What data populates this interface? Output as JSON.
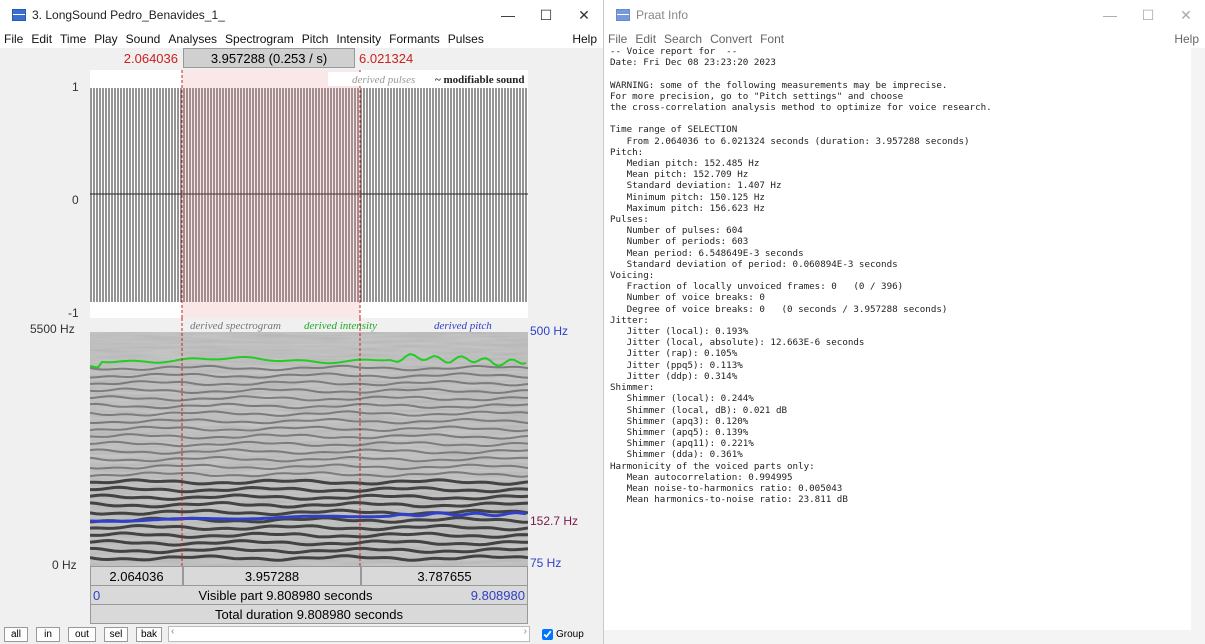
{
  "left": {
    "title": "3. LongSound Pedro_Benavides_1_",
    "menu": [
      "File",
      "Edit",
      "Time",
      "Play",
      "Sound",
      "Analyses",
      "Spectrogram",
      "Pitch",
      "Intensity",
      "Formants",
      "Pulses"
    ],
    "help": "Help",
    "sel_start": "2.064036",
    "sel_duration": "3.957288 (0.253 / s)",
    "sel_end": "6.021324",
    "wave": {
      "y_top": "1",
      "y_mid": "0",
      "y_bottom": "-1",
      "legend_pulses": "derived pulses",
      "legend_sound": "~ modifiable sound"
    },
    "spectro": {
      "freq_top": "5500 Hz",
      "freq_bottom": "0 Hz",
      "pitch_top": "500 Hz",
      "pitch_value": "152.7 Hz",
      "pitch_bottom": "75 Hz",
      "legend_spectrogram": "derived spectrogram",
      "legend_intensity": "derived intensity",
      "legend_pitch": "derived pitch"
    },
    "segments": [
      "2.064036",
      "3.957288",
      "3.787655"
    ],
    "visible_start": "0",
    "visible_label": "Visible part 9.808980 seconds",
    "visible_end": "9.808980",
    "total_label": "Total duration 9.808980 seconds",
    "buttons": [
      "all",
      "in",
      "out",
      "sel",
      "bak"
    ],
    "group_label": "Group",
    "group_checked": true
  },
  "right": {
    "title": "Praat Info",
    "menu": [
      "File",
      "Edit",
      "Search",
      "Convert",
      "Font"
    ],
    "help": "Help",
    "report": [
      "-- Voice report for  --",
      "Date: Fri Dec 08 23:23:20 2023",
      "",
      "WARNING: some of the following measurements may be imprecise.",
      "For more precision, go to \"Pitch settings\" and choose",
      "the cross-correlation analysis method to optimize for voice research.",
      "",
      "Time range of SELECTION",
      "   From 2.064036 to 6.021324 seconds (duration: 3.957288 seconds)",
      "Pitch:",
      "   Median pitch: 152.485 Hz",
      "   Mean pitch: 152.709 Hz",
      "   Standard deviation: 1.407 Hz",
      "   Minimum pitch: 150.125 Hz",
      "   Maximum pitch: 156.623 Hz",
      "Pulses:",
      "   Number of pulses: 604",
      "   Number of periods: 603",
      "   Mean period: 6.548649E-3 seconds",
      "   Standard deviation of period: 0.060894E-3 seconds",
      "Voicing:",
      "   Fraction of locally unvoiced frames: 0   (0 / 396)",
      "   Number of voice breaks: 0",
      "   Degree of voice breaks: 0   (0 seconds / 3.957288 seconds)",
      "Jitter:",
      "   Jitter (local): 0.193%",
      "   Jitter (local, absolute): 12.663E-6 seconds",
      "   Jitter (rap): 0.105%",
      "   Jitter (ppq5): 0.113%",
      "   Jitter (ddp): 0.314%",
      "Shimmer:",
      "   Shimmer (local): 0.244%",
      "   Shimmer (local, dB): 0.021 dB",
      "   Shimmer (apq3): 0.120%",
      "   Shimmer (apq5): 0.139%",
      "   Shimmer (apq11): 0.221%",
      "   Shimmer (dda): 0.361%",
      "Harmonicity of the voiced parts only:",
      "   Mean autocorrelation: 0.994995",
      "   Mean noise-to-harmonics ratio: 0.005043",
      "   Mean harmonics-to-noise ratio: 23.811 dB"
    ]
  },
  "colors": {
    "selection_red": "#cc2020",
    "pitch_blue": "#3040c8",
    "intensity_green": "#22cc22",
    "pitch_label": "#7a1a4a"
  }
}
